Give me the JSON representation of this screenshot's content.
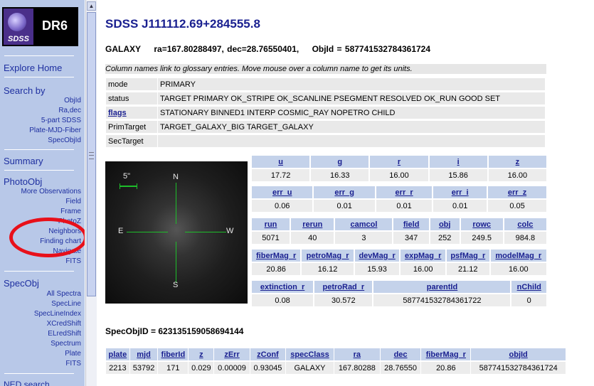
{
  "sidebar": {
    "logo_text": "SDSS",
    "release": "DR6",
    "explore_home": "Explore Home",
    "search_by": "Search by",
    "search_links": [
      "ObjId",
      "Ra,dec",
      "5-part SDSS",
      "Plate-MJD-Fiber",
      "SpecObjId"
    ],
    "summary": "Summary",
    "photoobj": "PhotoObj",
    "photo_links": [
      "More Observations",
      "Field",
      "Frame",
      "PhotoZ",
      "Neighbors",
      "Finding chart",
      "Navigate",
      "FITS"
    ],
    "specobj": "SpecObj",
    "spec_links": [
      "All Spectra",
      "SpecLine",
      "SpecLineIndex",
      "XCredShift",
      "ELredShift",
      "Spectrum",
      "Plate",
      "FITS"
    ],
    "ned": "NED search"
  },
  "colors": {
    "sidebar_bg": "#b8c8e8",
    "link": "#1a2090",
    "header_cell": "#c4d2ea",
    "highlight_circle": "#e8101a"
  },
  "main": {
    "title": "SDSS J111112.69+284555.8",
    "type": "GALAXY",
    "radec": "ra=167.80288497, dec=28.76550401,",
    "objid": "ObjId = 587741532784361724",
    "note": "Column names link to glossary entries. Move mouse over a column name to get its units.",
    "info_rows": [
      {
        "key": "mode",
        "value": "PRIMARY"
      },
      {
        "key": "status",
        "value": "TARGET PRIMARY OK_STRIPE OK_SCANLINE PSEGMENT RESOLVED OK_RUN GOOD SET"
      },
      {
        "key": "flags",
        "value": "STATIONARY BINNED1 INTERP COSMIC_RAY NOPETRO CHILD"
      },
      {
        "key": "PrimTarget",
        "value": "TARGET_GALAXY_BIG TARGET_GALAXY"
      },
      {
        "key": "SecTarget",
        "value": ""
      }
    ],
    "image": {
      "scale": "5\"",
      "north": "N",
      "south": "S",
      "east": "E",
      "west": "W"
    },
    "mags": {
      "headers": [
        "u",
        "g",
        "r",
        "i",
        "z"
      ],
      "values": [
        "17.72",
        "16.33",
        "16.00",
        "15.86",
        "16.00"
      ]
    },
    "errs": {
      "headers": [
        "err_u",
        "err_g",
        "err_r",
        "err_i",
        "err_z"
      ],
      "values": [
        "0.06",
        "0.01",
        "0.01",
        "0.01",
        "0.05"
      ]
    },
    "run": {
      "headers": [
        "run",
        "rerun",
        "camcol",
        "field",
        "obj",
        "rowc",
        "colc"
      ],
      "values": [
        "5071",
        "40",
        "3",
        "347",
        "252",
        "249.5",
        "984.8"
      ]
    },
    "magr": {
      "headers": [
        "fiberMag_r",
        "petroMag_r",
        "devMag_r",
        "expMag_r",
        "psfMag_r",
        "modelMag_r"
      ],
      "values": [
        "20.86",
        "16.12",
        "15.93",
        "16.00",
        "21.12",
        "16.00"
      ]
    },
    "ext": {
      "headers": [
        "extinction_r",
        "petroRad_r",
        "parentId",
        "nChild"
      ],
      "values": [
        "0.08",
        "30.572",
        "587741532784361722",
        "0"
      ]
    },
    "specobjid": "SpecObjID = 623135159058694144",
    "spec": {
      "headers": [
        "plate",
        "mjd",
        "fiberId",
        "z",
        "zErr",
        "zConf",
        "specClass",
        "ra",
        "dec",
        "fiberMag_r",
        "objId"
      ],
      "values": [
        "2213",
        "53792",
        "171",
        "0.029",
        "0.00009",
        "0.93045",
        "GALAXY",
        "167.80288",
        "28.76550",
        "20.86",
        "587741532784361724"
      ]
    }
  }
}
